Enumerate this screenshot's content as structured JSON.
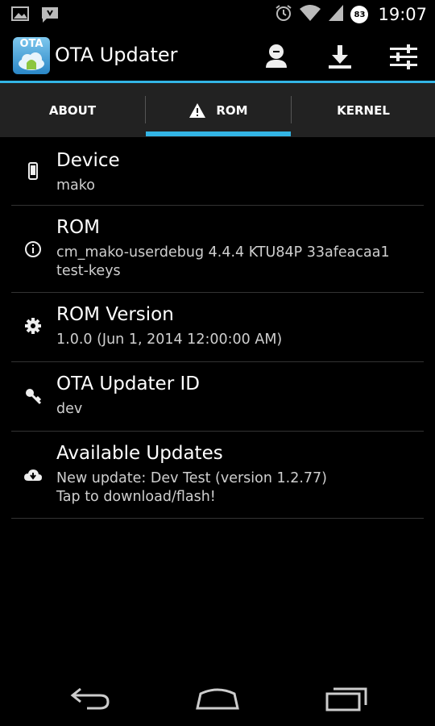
{
  "status_bar": {
    "time": "19:07",
    "battery_level": "83",
    "left_icons": [
      "image-icon",
      "message-icon"
    ],
    "right_icons": [
      "alarm-icon",
      "wifi-icon",
      "cell-signal-icon",
      "battery-icon"
    ]
  },
  "action_bar": {
    "title": "OTA Updater",
    "logo_text": "OTA",
    "actions": [
      "account-icon",
      "download-icon",
      "settings-sliders-icon"
    ],
    "accent_color": "#33b5e5"
  },
  "tabs": [
    {
      "label": "ABOUT",
      "selected": false
    },
    {
      "label": "ROM",
      "selected": true,
      "icon": "warning-icon"
    },
    {
      "label": "KERNEL",
      "selected": false
    }
  ],
  "list": [
    {
      "icon": "phone-icon",
      "title": "Device",
      "lines": [
        "mako"
      ]
    },
    {
      "icon": "info-icon",
      "title": "ROM",
      "lines": [
        "cm_mako-userdebug 4.4.4 KTU84P 33afeacaa1",
        "test-keys"
      ]
    },
    {
      "icon": "gear-icon",
      "title": "ROM Version",
      "lines": [
        "1.0.0 (Jun 1, 2014 12:00:00 AM)"
      ]
    },
    {
      "icon": "key-icon",
      "title": "OTA Updater ID",
      "lines": [
        "dev"
      ]
    },
    {
      "icon": "cloud-download-icon",
      "title": "Available Updates",
      "lines": [
        "New update: Dev Test (version 1.2.77)",
        "Tap to download/flash!"
      ]
    }
  ],
  "nav_bar": {
    "buttons": [
      "back-icon",
      "home-icon",
      "recent-apps-icon"
    ]
  }
}
